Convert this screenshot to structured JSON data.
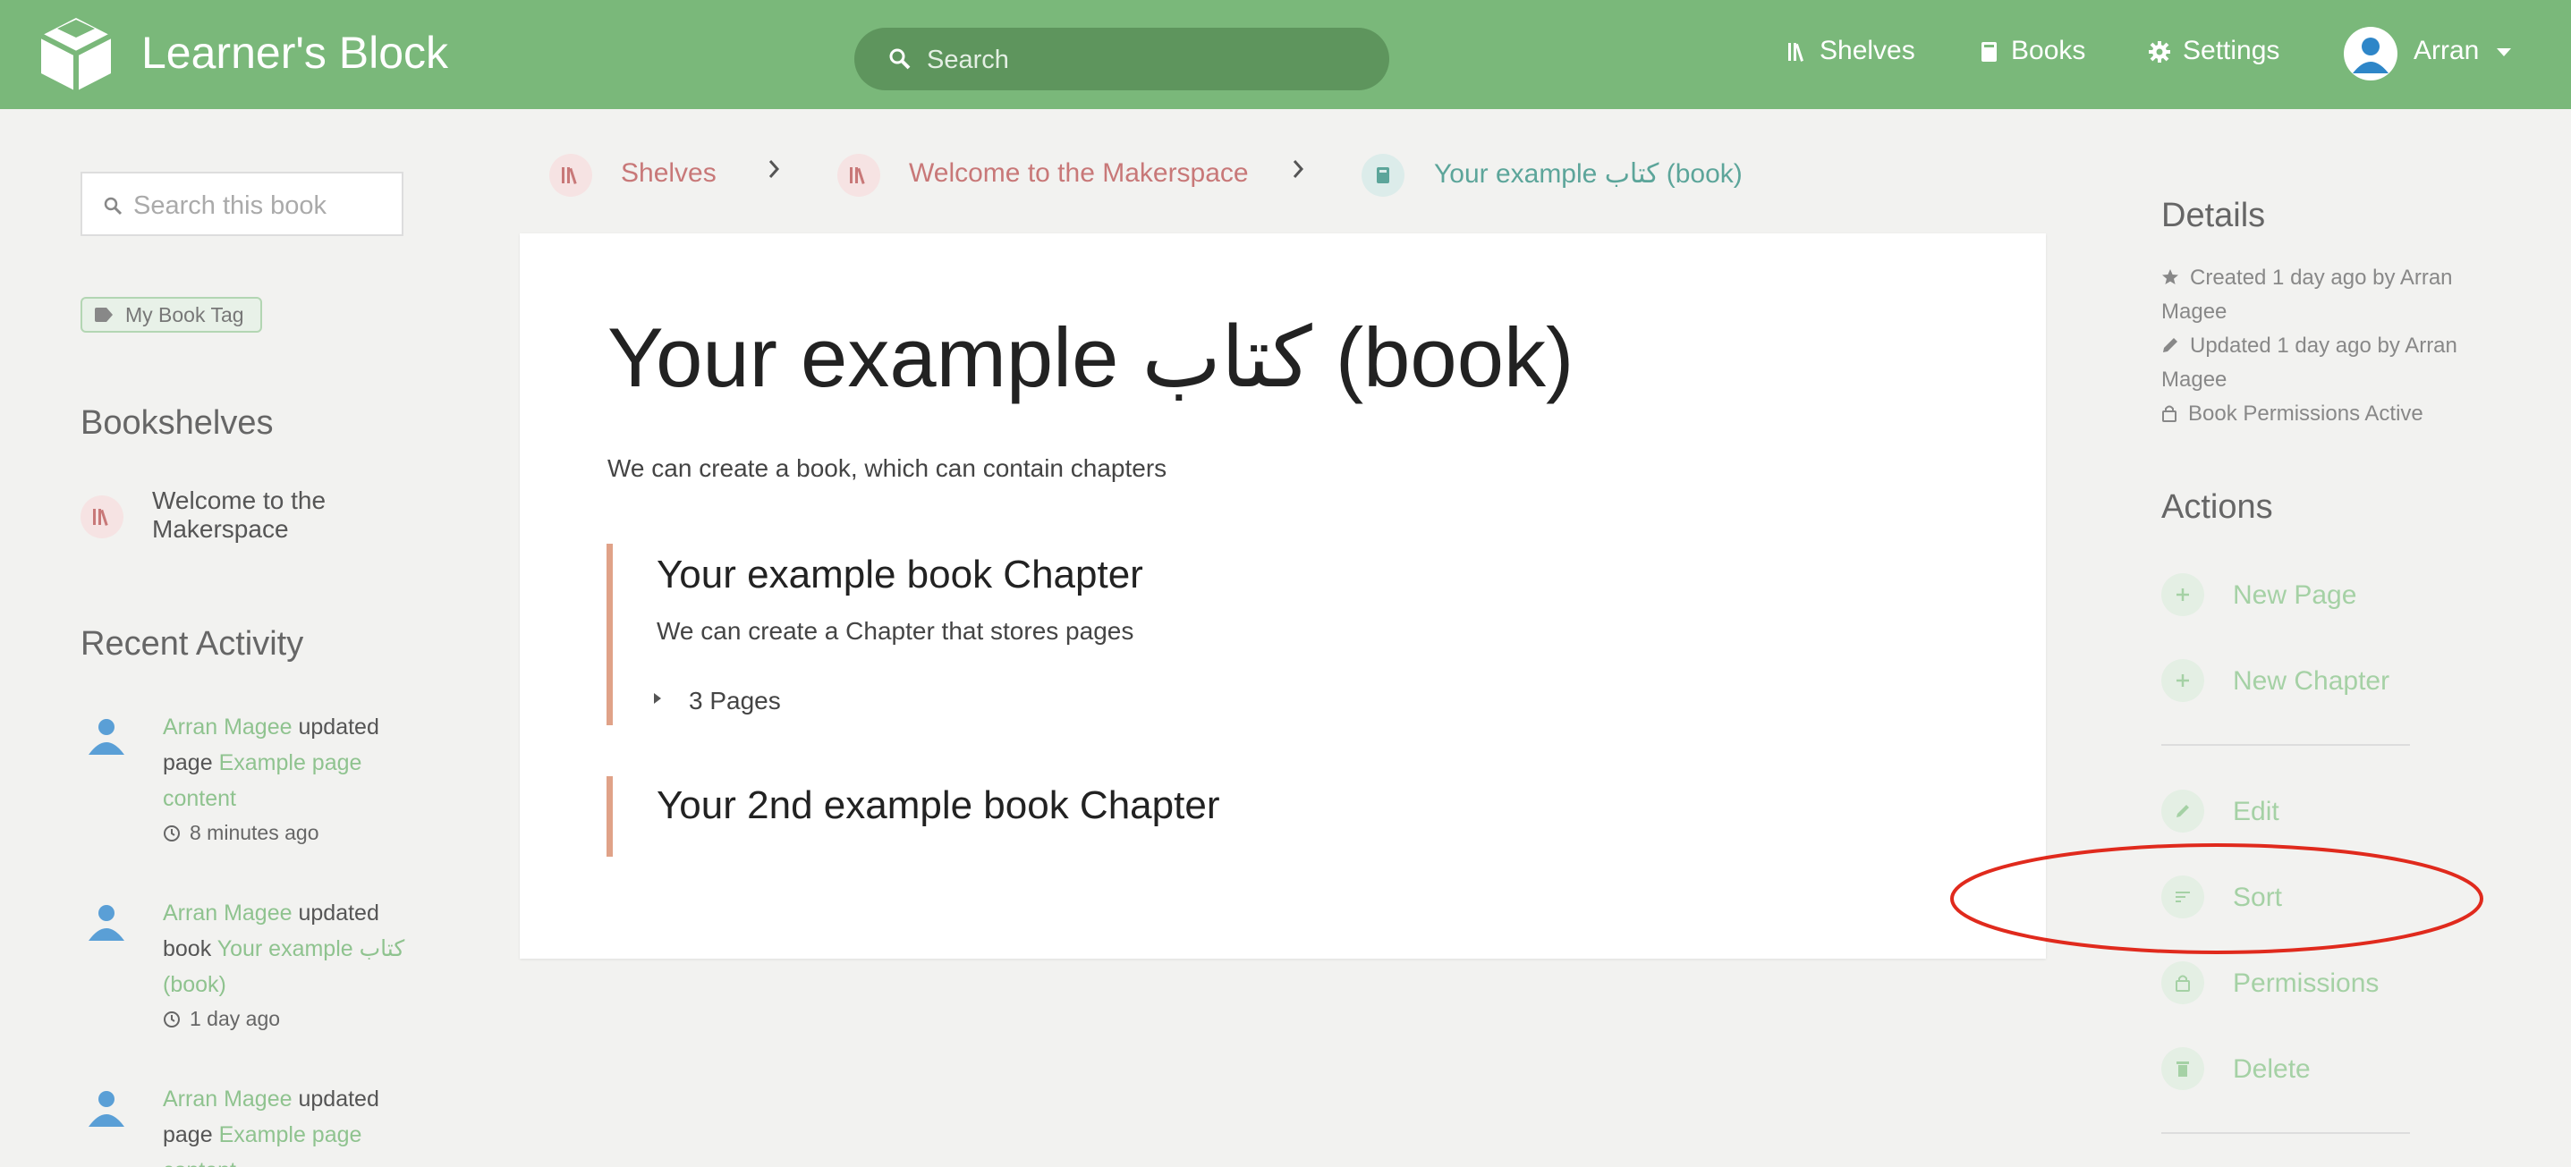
{
  "header": {
    "app_title": "Learner's Block",
    "search_placeholder": "Search",
    "nav": {
      "shelves": "Shelves",
      "books": "Books",
      "settings": "Settings",
      "user": "Arran"
    }
  },
  "left": {
    "search_placeholder": "Search this book",
    "tag": "My Book Tag",
    "bookshelves_heading": "Bookshelves",
    "shelf_item": "Welcome to the Makerspace",
    "recent_heading": "Recent Activity",
    "activity": [
      {
        "user": "Arran Magee",
        "action": "updated page",
        "target": "Example page content",
        "time": "8 minutes ago"
      },
      {
        "user": "Arran Magee",
        "action": "updated book",
        "target": "Your example كتاب (book)",
        "time": "1 day ago"
      },
      {
        "user": "Arran Magee",
        "action": "updated page",
        "target": "Example page content",
        "time": ""
      }
    ]
  },
  "breadcrumb": [
    "Shelves",
    "Welcome to the Makerspace",
    "Your example كتاب (book)"
  ],
  "book": {
    "title": "Your example كتاب (book)",
    "description": "We can create a book, which can contain chapters",
    "chapters": [
      {
        "title": "Your example book Chapter",
        "description": "We can create a Chapter that stores pages",
        "pages": "3 Pages"
      },
      {
        "title": "Your 2nd example book Chapter"
      }
    ]
  },
  "right": {
    "details_heading": "Details",
    "created": "Created 1 day ago by Arran Magee",
    "updated": "Updated 1 day ago by Arran Magee",
    "permissions": "Book Permissions Active",
    "actions_heading": "Actions",
    "actions": {
      "new_page": "New Page",
      "new_chapter": "New Chapter",
      "edit": "Edit",
      "sort": "Sort",
      "permissions": "Permissions",
      "delete": "Delete"
    }
  },
  "colors": {
    "header": "#7ab87a",
    "shelf": "#c87878",
    "book": "#5ca59a",
    "chapter": "#e0a288",
    "annotation": "#e02a1d"
  }
}
